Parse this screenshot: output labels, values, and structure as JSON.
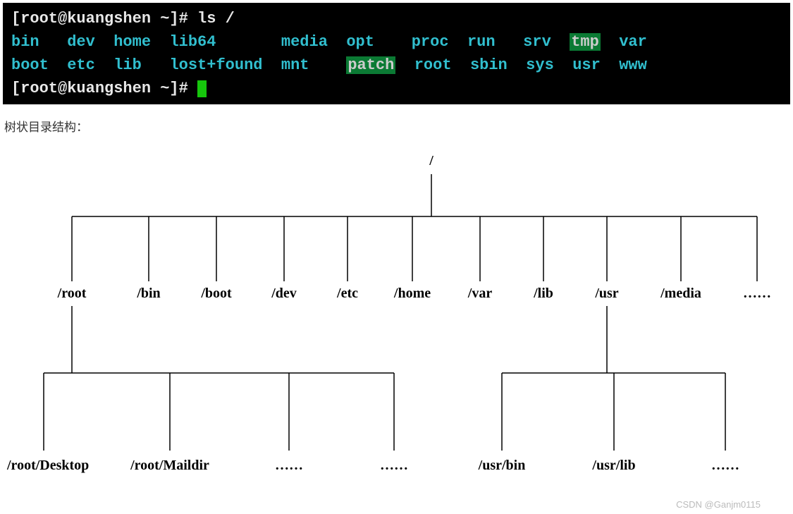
{
  "terminal": {
    "prompt1_left": "[root@kuangshen ~]# ",
    "prompt1_cmd": "ls /",
    "row1": [
      "bin",
      "dev",
      "home",
      "lib64",
      "media",
      "opt",
      "proc",
      "run",
      "srv",
      "tmp",
      "var"
    ],
    "row2": [
      "boot",
      "etc",
      "lib",
      "lost+found",
      "mnt",
      "patch",
      "root",
      "sbin",
      "sys",
      "usr",
      "www"
    ],
    "prompt2_left": "[root@kuangshen ~]# ",
    "highlight": [
      "tmp",
      "patch"
    ]
  },
  "caption": "树状目录结构：",
  "tree": {
    "root": "/",
    "level1": [
      "/root",
      "/bin",
      "/boot",
      "/dev",
      "/etc",
      "/home",
      "/var",
      "/lib",
      "/usr",
      "/media",
      "……"
    ],
    "level2_root": [
      "/root/Desktop",
      "/root/Maildir",
      "……",
      "……"
    ],
    "level2_usr": [
      "/usr/bin",
      "/usr/lib",
      "……"
    ]
  },
  "watermark": "CSDN @Ganjm0115"
}
